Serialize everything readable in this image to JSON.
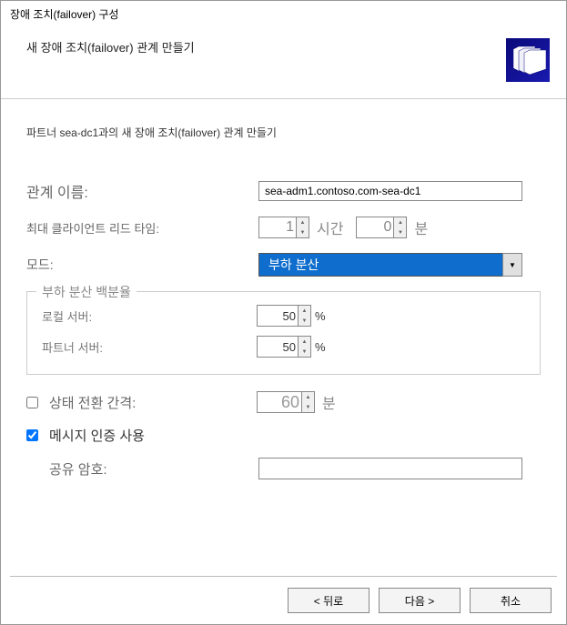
{
  "window": {
    "title": "장애 조치(failover) 구성"
  },
  "header": {
    "subtitle": "새 장애 조치(failover) 관계 만들기"
  },
  "intro": "파트너 sea-dc1과의 새 장애 조치(failover) 관계 만들기",
  "form": {
    "relation_name_label": "관계 이름:",
    "relation_name_value": "sea-adm1.contoso.com-sea-dc1",
    "max_client_lead_label": "최대 클라이언트 리드 타임:",
    "max_hours_value": "1",
    "hours_unit": "시간",
    "max_minutes_value": "0",
    "minutes_unit": "분",
    "mode_label": "모드:",
    "mode_value": "부하 분산",
    "load_balance_group": "부하 분산 백분율",
    "local_server_label": "로컬 서버:",
    "local_server_value": "50",
    "partner_server_label": "파트너 서버:",
    "partner_server_value": "50",
    "state_interval_label": "상태 전환 간격:",
    "state_interval_value": "60",
    "msg_auth_label": "메시지 인증 사용",
    "shared_secret_label": "공유 암호:",
    "shared_secret_value": ""
  },
  "buttons": {
    "back": "< 뒤로",
    "next": "다음 >",
    "cancel": "취소"
  },
  "percent": "%"
}
